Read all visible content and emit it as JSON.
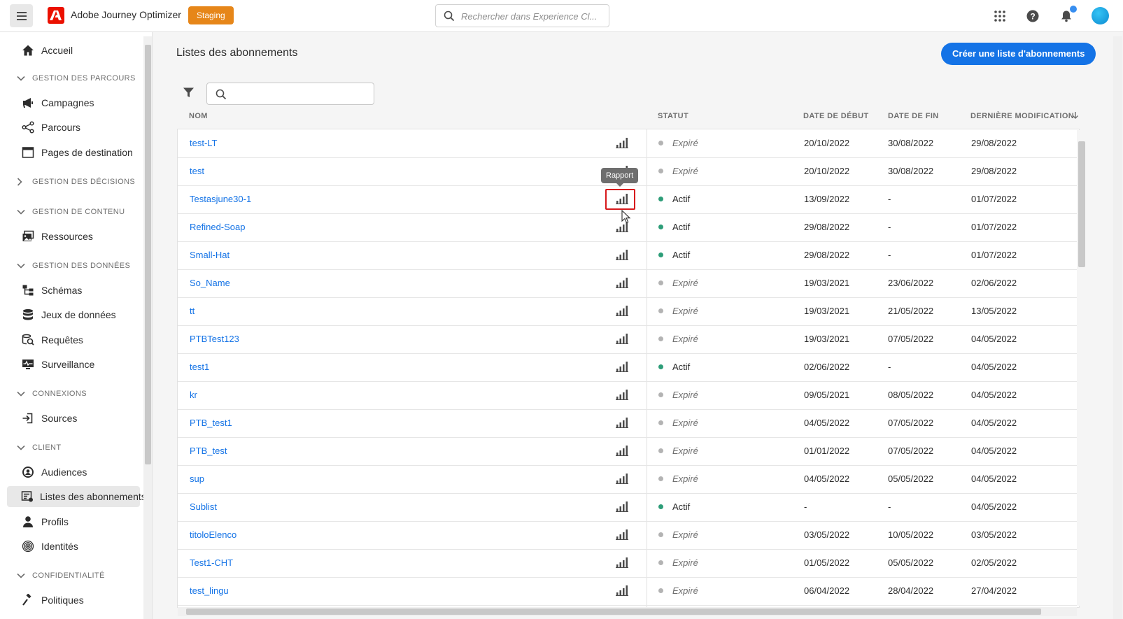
{
  "app": {
    "title": "Adobe Journey Optimizer",
    "environment": "Staging",
    "search_placeholder": "Rechercher dans Experience Cl...",
    "accent_color": "#1473e6"
  },
  "sidebar": {
    "home": "Accueil",
    "sections": {
      "journey_mgmt": "GESTION DES PARCOURS",
      "decision_mgmt": "GESTION DES DÉCISIONS",
      "content_mgmt": "GESTION DE CONTENU",
      "data_mgmt": "GESTION DES DONNÉES",
      "connections": "CONNEXIONS",
      "client": "CLIENT",
      "privacy": "CONFIDENTIALITÉ"
    },
    "items": {
      "campaigns": "Campagnes",
      "journeys": "Parcours",
      "landing_pages": "Pages de destination",
      "assets": "Ressources",
      "schemas": "Schémas",
      "datasets": "Jeux de données",
      "queries": "Requêtes",
      "monitoring": "Surveillance",
      "sources": "Sources",
      "audiences": "Audiences",
      "subscription_lists": "Listes des abonnements",
      "profiles": "Profils",
      "identities": "Identités",
      "policies": "Politiques"
    }
  },
  "main": {
    "title": "Listes des abonnements",
    "create_button": "Créer une liste d'abonnements",
    "columns": {
      "name": "NOM",
      "status": "STATUT",
      "start": "DATE DE DÉBUT",
      "end": "DATE DE FIN",
      "modified": "DERNIÈRE MODIFICATION"
    },
    "tooltip": "Rapport",
    "rows": [
      {
        "name": "test-LT",
        "status": "Expiré",
        "start": "20/10/2022",
        "end": "30/08/2022",
        "modified": "29/08/2022"
      },
      {
        "name": "test",
        "status": "Expiré",
        "start": "20/10/2022",
        "end": "30/08/2022",
        "modified": "29/08/2022"
      },
      {
        "name": "Testasjune30-1",
        "status": "Actif",
        "start": "13/09/2022",
        "end": "-",
        "modified": "01/07/2022"
      },
      {
        "name": "Refined-Soap",
        "status": "Actif",
        "start": "29/08/2022",
        "end": "-",
        "modified": "01/07/2022"
      },
      {
        "name": "Small-Hat",
        "status": "Actif",
        "start": "29/08/2022",
        "end": "-",
        "modified": "01/07/2022"
      },
      {
        "name": "So_Name",
        "status": "Expiré",
        "start": "19/03/2021",
        "end": "23/06/2022",
        "modified": "02/06/2022"
      },
      {
        "name": "tt",
        "status": "Expiré",
        "start": "19/03/2021",
        "end": "21/05/2022",
        "modified": "13/05/2022"
      },
      {
        "name": "PTBTest123",
        "status": "Expiré",
        "start": "19/03/2021",
        "end": "07/05/2022",
        "modified": "04/05/2022"
      },
      {
        "name": "test1",
        "status": "Actif",
        "start": "02/06/2022",
        "end": "-",
        "modified": "04/05/2022"
      },
      {
        "name": "kr",
        "status": "Expiré",
        "start": "09/05/2021",
        "end": "08/05/2022",
        "modified": "04/05/2022"
      },
      {
        "name": "PTB_test1",
        "status": "Expiré",
        "start": "04/05/2022",
        "end": "07/05/2022",
        "modified": "04/05/2022"
      },
      {
        "name": "PTB_test",
        "status": "Expiré",
        "start": "01/01/2022",
        "end": "07/05/2022",
        "modified": "04/05/2022"
      },
      {
        "name": "sup",
        "status": "Expiré",
        "start": "04/05/2022",
        "end": "05/05/2022",
        "modified": "04/05/2022"
      },
      {
        "name": "Sublist",
        "status": "Actif",
        "start": "-",
        "end": "-",
        "modified": "04/05/2022"
      },
      {
        "name": "titoloElenco",
        "status": "Expiré",
        "start": "03/05/2022",
        "end": "10/05/2022",
        "modified": "03/05/2022"
      },
      {
        "name": "Test1-CHT",
        "status": "Expiré",
        "start": "01/05/2022",
        "end": "05/05/2022",
        "modified": "02/05/2022"
      },
      {
        "name": "test_lingu",
        "status": "Expiré",
        "start": "06/04/2022",
        "end": "28/04/2022",
        "modified": "27/04/2022"
      }
    ]
  }
}
